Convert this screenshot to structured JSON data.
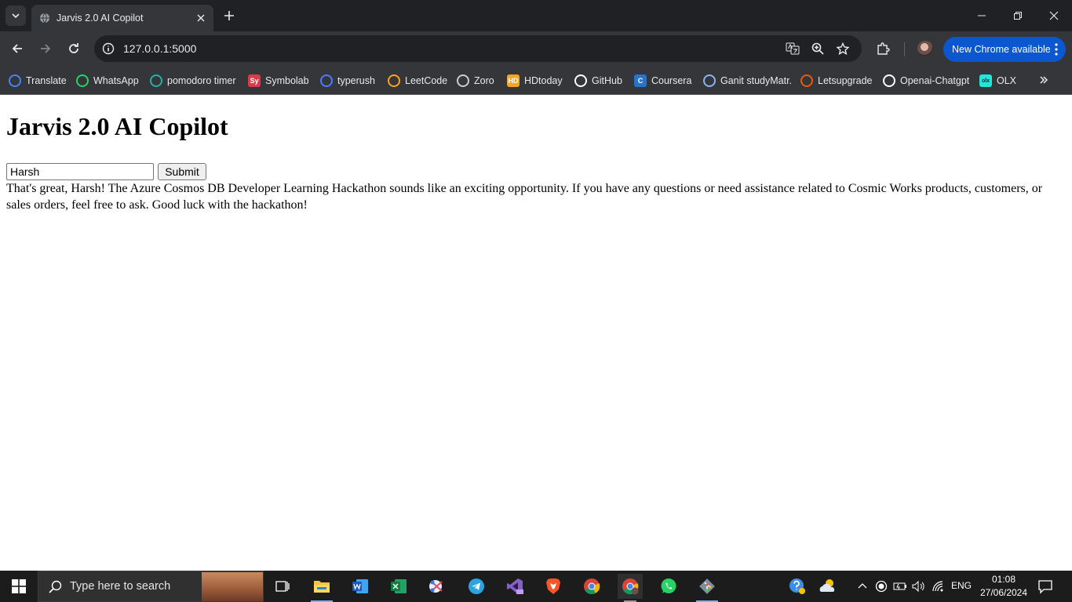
{
  "browser": {
    "tab": {
      "title": "Jarvis 2.0 AI Copilot"
    },
    "address_bar": {
      "url": "127.0.0.1:5000"
    },
    "update_button_label": "New Chrome available",
    "bookmarks": [
      {
        "label": "Translate",
        "icon": "google-translate-icon",
        "color": "#4285f4"
      },
      {
        "label": "WhatsApp",
        "icon": "whatsapp-icon",
        "color": "#25d366"
      },
      {
        "label": "pomodoro timer",
        "icon": "check-circle-icon",
        "color": "#20b2aa"
      },
      {
        "label": "Symbolab",
        "icon": "symbolab-icon",
        "color": "#dd3b4c",
        "glyph": "Sy"
      },
      {
        "label": "typerush",
        "icon": "typerush-icon",
        "color": "#4a7dff"
      },
      {
        "label": "LeetCode",
        "icon": "leetcode-icon",
        "color": "#ffa116"
      },
      {
        "label": "Zoro",
        "icon": "zoro-icon",
        "color": "#cccccc"
      },
      {
        "label": "HDtoday",
        "icon": "hdtoday-icon",
        "color": "#f5a623",
        "glyph": "HD"
      },
      {
        "label": "GitHub",
        "icon": "github-icon",
        "color": "#ffffff"
      },
      {
        "label": "Coursera",
        "icon": "coursera-icon",
        "color": "#2a73cc",
        "glyph": "C"
      },
      {
        "label": "Ganit studyMatr.",
        "icon": "ganit-icon",
        "color": "#8ab4f8"
      },
      {
        "label": "Letsupgrade",
        "icon": "letsupgrade-icon",
        "color": "#e8590c"
      },
      {
        "label": "Openai-Chatgpt",
        "icon": "openai-icon",
        "color": "#ffffff"
      },
      {
        "label": "OLX",
        "icon": "olx-icon",
        "color": "#23e5db",
        "glyph": "olx"
      }
    ]
  },
  "page": {
    "heading": "Jarvis 2.0 AI Copilot",
    "input_value": "Harsh",
    "submit_label": "Submit",
    "response": "That's great, Harsh! The Azure Cosmos DB Developer Learning Hackathon sounds like an exciting opportunity. If you have any questions or need assistance related to Cosmic Works products, customers, or sales orders, feel free to ask. Good luck with the hackathon!"
  },
  "taskbar": {
    "search_placeholder": "Type here to search",
    "apps": [
      "task-view-icon",
      "file-explorer-icon",
      "word-icon",
      "excel-icon",
      "snipping-tool-icon",
      "telegram-icon",
      "visual-studio-icon",
      "brave-icon",
      "chrome-icon",
      "chrome-profile-icon",
      "whatsapp-icon",
      "git-icon"
    ],
    "language": "ENG",
    "time": "01:08",
    "date": "27/06/2024"
  },
  "colors": {
    "accent": "#0b57d0",
    "taskbar_bg": "#1c1c1c",
    "chrome_dark": "#35363a"
  }
}
